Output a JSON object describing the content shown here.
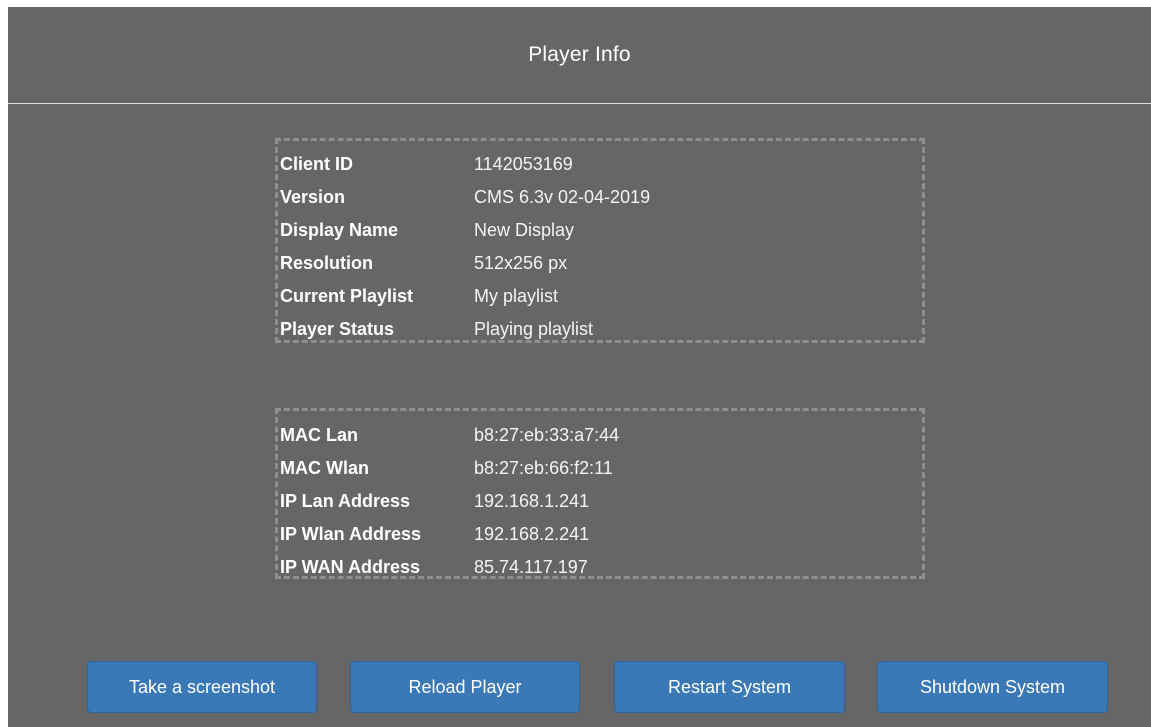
{
  "header": {
    "title": "Player Info"
  },
  "player_info": [
    {
      "label": "Client ID",
      "value": "1142053169"
    },
    {
      "label": "Version",
      "value": "CMS 6.3v 02-04-2019"
    },
    {
      "label": "Display Name",
      "value": "New Display"
    },
    {
      "label": "Resolution",
      "value": "512x256 px"
    },
    {
      "label": "Current Playlist",
      "value": "My playlist"
    },
    {
      "label": "Player Status",
      "value": "Playing playlist"
    }
  ],
  "network_info": [
    {
      "label": "MAC Lan",
      "value": "b8:27:eb:33:a7:44"
    },
    {
      "label": "MAC Wlan",
      "value": "b8:27:eb:66:f2:11"
    },
    {
      "label": "IP Lan Address",
      "value": "192.168.1.241"
    },
    {
      "label": "IP Wlan Address",
      "value": "192.168.2.241"
    },
    {
      "label": "IP WAN Address",
      "value": "85.74.117.197"
    }
  ],
  "buttons": {
    "screenshot": "Take a screenshot",
    "reload": "Reload Player",
    "restart": "Restart System",
    "shutdown": "Shutdown System"
  },
  "colors": {
    "panel_background": "#666666",
    "button_blue": "#3a78b6",
    "box_border": "#8f8f8f",
    "text": "#ffffff"
  }
}
